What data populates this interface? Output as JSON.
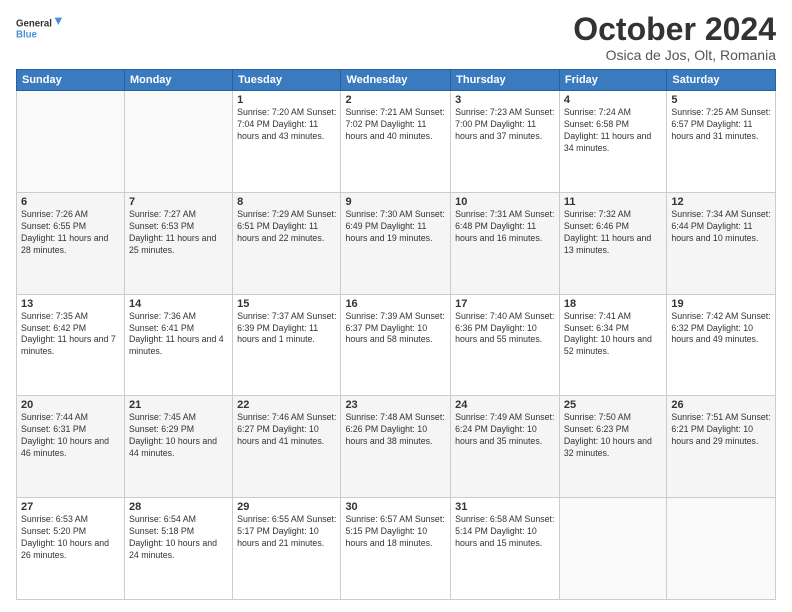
{
  "header": {
    "logo_line1": "General",
    "logo_line2": "Blue",
    "month": "October 2024",
    "location": "Osica de Jos, Olt, Romania"
  },
  "weekdays": [
    "Sunday",
    "Monday",
    "Tuesday",
    "Wednesday",
    "Thursday",
    "Friday",
    "Saturday"
  ],
  "weeks": [
    [
      {
        "day": "",
        "info": ""
      },
      {
        "day": "",
        "info": ""
      },
      {
        "day": "1",
        "info": "Sunrise: 7:20 AM\nSunset: 7:04 PM\nDaylight: 11 hours and 43 minutes."
      },
      {
        "day": "2",
        "info": "Sunrise: 7:21 AM\nSunset: 7:02 PM\nDaylight: 11 hours and 40 minutes."
      },
      {
        "day": "3",
        "info": "Sunrise: 7:23 AM\nSunset: 7:00 PM\nDaylight: 11 hours and 37 minutes."
      },
      {
        "day": "4",
        "info": "Sunrise: 7:24 AM\nSunset: 6:58 PM\nDaylight: 11 hours and 34 minutes."
      },
      {
        "day": "5",
        "info": "Sunrise: 7:25 AM\nSunset: 6:57 PM\nDaylight: 11 hours and 31 minutes."
      }
    ],
    [
      {
        "day": "6",
        "info": "Sunrise: 7:26 AM\nSunset: 6:55 PM\nDaylight: 11 hours and 28 minutes."
      },
      {
        "day": "7",
        "info": "Sunrise: 7:27 AM\nSunset: 6:53 PM\nDaylight: 11 hours and 25 minutes."
      },
      {
        "day": "8",
        "info": "Sunrise: 7:29 AM\nSunset: 6:51 PM\nDaylight: 11 hours and 22 minutes."
      },
      {
        "day": "9",
        "info": "Sunrise: 7:30 AM\nSunset: 6:49 PM\nDaylight: 11 hours and 19 minutes."
      },
      {
        "day": "10",
        "info": "Sunrise: 7:31 AM\nSunset: 6:48 PM\nDaylight: 11 hours and 16 minutes."
      },
      {
        "day": "11",
        "info": "Sunrise: 7:32 AM\nSunset: 6:46 PM\nDaylight: 11 hours and 13 minutes."
      },
      {
        "day": "12",
        "info": "Sunrise: 7:34 AM\nSunset: 6:44 PM\nDaylight: 11 hours and 10 minutes."
      }
    ],
    [
      {
        "day": "13",
        "info": "Sunrise: 7:35 AM\nSunset: 6:42 PM\nDaylight: 11 hours and 7 minutes."
      },
      {
        "day": "14",
        "info": "Sunrise: 7:36 AM\nSunset: 6:41 PM\nDaylight: 11 hours and 4 minutes."
      },
      {
        "day": "15",
        "info": "Sunrise: 7:37 AM\nSunset: 6:39 PM\nDaylight: 11 hours and 1 minute."
      },
      {
        "day": "16",
        "info": "Sunrise: 7:39 AM\nSunset: 6:37 PM\nDaylight: 10 hours and 58 minutes."
      },
      {
        "day": "17",
        "info": "Sunrise: 7:40 AM\nSunset: 6:36 PM\nDaylight: 10 hours and 55 minutes."
      },
      {
        "day": "18",
        "info": "Sunrise: 7:41 AM\nSunset: 6:34 PM\nDaylight: 10 hours and 52 minutes."
      },
      {
        "day": "19",
        "info": "Sunrise: 7:42 AM\nSunset: 6:32 PM\nDaylight: 10 hours and 49 minutes."
      }
    ],
    [
      {
        "day": "20",
        "info": "Sunrise: 7:44 AM\nSunset: 6:31 PM\nDaylight: 10 hours and 46 minutes."
      },
      {
        "day": "21",
        "info": "Sunrise: 7:45 AM\nSunset: 6:29 PM\nDaylight: 10 hours and 44 minutes."
      },
      {
        "day": "22",
        "info": "Sunrise: 7:46 AM\nSunset: 6:27 PM\nDaylight: 10 hours and 41 minutes."
      },
      {
        "day": "23",
        "info": "Sunrise: 7:48 AM\nSunset: 6:26 PM\nDaylight: 10 hours and 38 minutes."
      },
      {
        "day": "24",
        "info": "Sunrise: 7:49 AM\nSunset: 6:24 PM\nDaylight: 10 hours and 35 minutes."
      },
      {
        "day": "25",
        "info": "Sunrise: 7:50 AM\nSunset: 6:23 PM\nDaylight: 10 hours and 32 minutes."
      },
      {
        "day": "26",
        "info": "Sunrise: 7:51 AM\nSunset: 6:21 PM\nDaylight: 10 hours and 29 minutes."
      }
    ],
    [
      {
        "day": "27",
        "info": "Sunrise: 6:53 AM\nSunset: 5:20 PM\nDaylight: 10 hours and 26 minutes."
      },
      {
        "day": "28",
        "info": "Sunrise: 6:54 AM\nSunset: 5:18 PM\nDaylight: 10 hours and 24 minutes."
      },
      {
        "day": "29",
        "info": "Sunrise: 6:55 AM\nSunset: 5:17 PM\nDaylight: 10 hours and 21 minutes."
      },
      {
        "day": "30",
        "info": "Sunrise: 6:57 AM\nSunset: 5:15 PM\nDaylight: 10 hours and 18 minutes."
      },
      {
        "day": "31",
        "info": "Sunrise: 6:58 AM\nSunset: 5:14 PM\nDaylight: 10 hours and 15 minutes."
      },
      {
        "day": "",
        "info": ""
      },
      {
        "day": "",
        "info": ""
      }
    ]
  ]
}
